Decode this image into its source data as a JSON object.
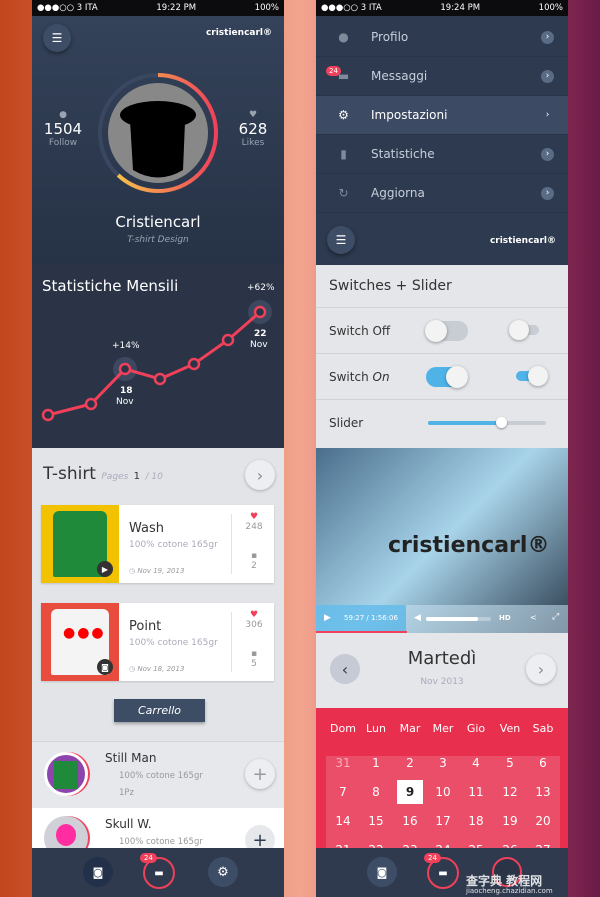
{
  "left": {
    "status": {
      "carrier": "●●●○○ 3 ITA",
      "time": "19:22 PM",
      "battery": "100%"
    },
    "logo": "cristiencarl®",
    "profile": {
      "follow_count": "1504",
      "follow_label": "Follow",
      "likes_count": "628",
      "likes_label": "Likes",
      "name": "Cristiencarl",
      "subtitle": "T-shirt Design",
      "ring_progress": 0.62
    },
    "stats": {
      "title": "Statistiche Mensili",
      "label1": "+14%",
      "label1_date": "18",
      "label1_month": "Nov",
      "label2": "+62%",
      "label2_date": "22",
      "label2_month": "Nov"
    },
    "tshirt": {
      "title": "T-shirt",
      "pages_label": "Pages",
      "page": "1",
      "total": "/ 10",
      "cards": [
        {
          "name": "Wash",
          "desc": "100% cotone 165gr",
          "date": "Nov 19, 2013",
          "likes": "248",
          "comments": "2",
          "bg": "#f2c200",
          "media": "play-icon"
        },
        {
          "name": "Point",
          "desc": "100% cotone 165gr",
          "date": "Nov 18, 2013",
          "likes": "306",
          "comments": "5",
          "bg": "#e74c3c",
          "media": "camera-icon"
        }
      ],
      "cart_button": "Carrello"
    },
    "list": [
      {
        "name": "Still Man",
        "desc": "100% cotone 165gr",
        "qty": "1Pz"
      },
      {
        "name": "Skull W.",
        "desc": "100% cotone 165gr"
      }
    ],
    "nav": {
      "badge": "24"
    }
  },
  "right": {
    "status": {
      "carrier": "●●●○○ 3 ITA",
      "time": "19:24 PM",
      "battery": "100%"
    },
    "menu": [
      {
        "label": "Profilo",
        "icon": "user-icon"
      },
      {
        "label": "Messaggi",
        "icon": "messages-icon",
        "badge": "24"
      },
      {
        "label": "Impostazioni",
        "icon": "gear-icon",
        "active": true
      },
      {
        "label": "Statistiche",
        "icon": "bar-chart-icon"
      },
      {
        "label": "Aggiorna",
        "icon": "refresh-icon"
      }
    ],
    "logo": "cristiencarl®",
    "switches": {
      "title": "Switches + Slider",
      "switch_off": "Switch Off",
      "switch_on_prefix": "Switch",
      "switch_on_em": "On",
      "slider": "Slider",
      "slider_value": 0.62
    },
    "video": {
      "time": "59:27 / 1:56:06",
      "hd": "HD",
      "watermark": "cristiencarl®",
      "progress": 0.36,
      "volume": 0.8
    },
    "calendar": {
      "day": "Martedì",
      "month": "Nov 2013",
      "weekdays": [
        "Dom",
        "Lun",
        "Mar",
        "Mer",
        "Gio",
        "Ven",
        "Sab"
      ],
      "weeks": [
        [
          "31",
          "1",
          "2",
          "3",
          "4",
          "5",
          "6"
        ],
        [
          "7",
          "8",
          "9",
          "10",
          "11",
          "12",
          "13"
        ],
        [
          "14",
          "15",
          "16",
          "17",
          "18",
          "19",
          "20"
        ],
        [
          "21",
          "22",
          "23",
          "24",
          "25",
          "26",
          "27"
        ]
      ],
      "selected": "9"
    },
    "nav": {
      "badge": "24"
    },
    "watermark": "查字典 教程网",
    "watermark_url": "jiaocheng.chazidian.com"
  },
  "colors": {
    "accent": "#f0405a",
    "navy": "#2e3a4f",
    "blue": "#4fb3e8",
    "yellow": "#f7d848"
  }
}
